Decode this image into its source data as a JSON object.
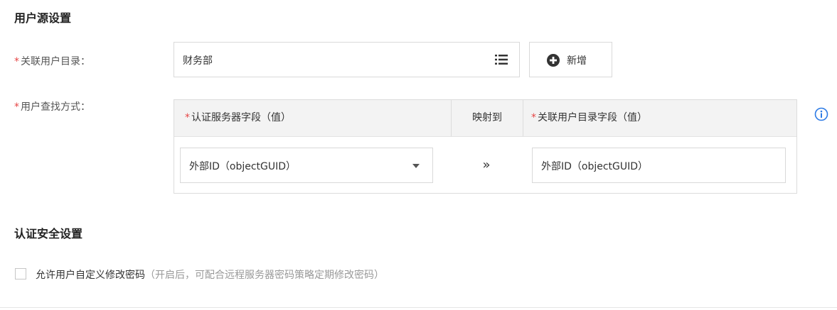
{
  "user_source": {
    "section_title": "用户源设置",
    "required_mark": "*",
    "directory_label": "关联用户目录：",
    "directory_value": "财务部",
    "add_button_label": "新增",
    "lookup_label": "用户查找方式：",
    "mapping": {
      "col_auth_field": "认证服务器字段（值）",
      "col_map_to": "映射到",
      "col_dir_field": "关联用户目录字段（值）",
      "auth_field_value": "外部ID（objectGUID）",
      "arrow": "»",
      "dir_field_value": "外部ID（objectGUID）"
    }
  },
  "auth_security": {
    "section_title": "认证安全设置",
    "allow_custom_password": {
      "checked": false,
      "label": "允许用户自定义修改密码",
      "hint": "（开启后，可配合远程服务器密码策略定期修改密码）"
    }
  },
  "colors": {
    "required": "#e64545",
    "info": "#2d7be5",
    "table_header_bg": "#f3f3f3"
  },
  "icons": {
    "list": "list-icon",
    "add": "plus-circle-icon",
    "info": "info-circle-icon",
    "dropdown": "caret-down-icon"
  }
}
